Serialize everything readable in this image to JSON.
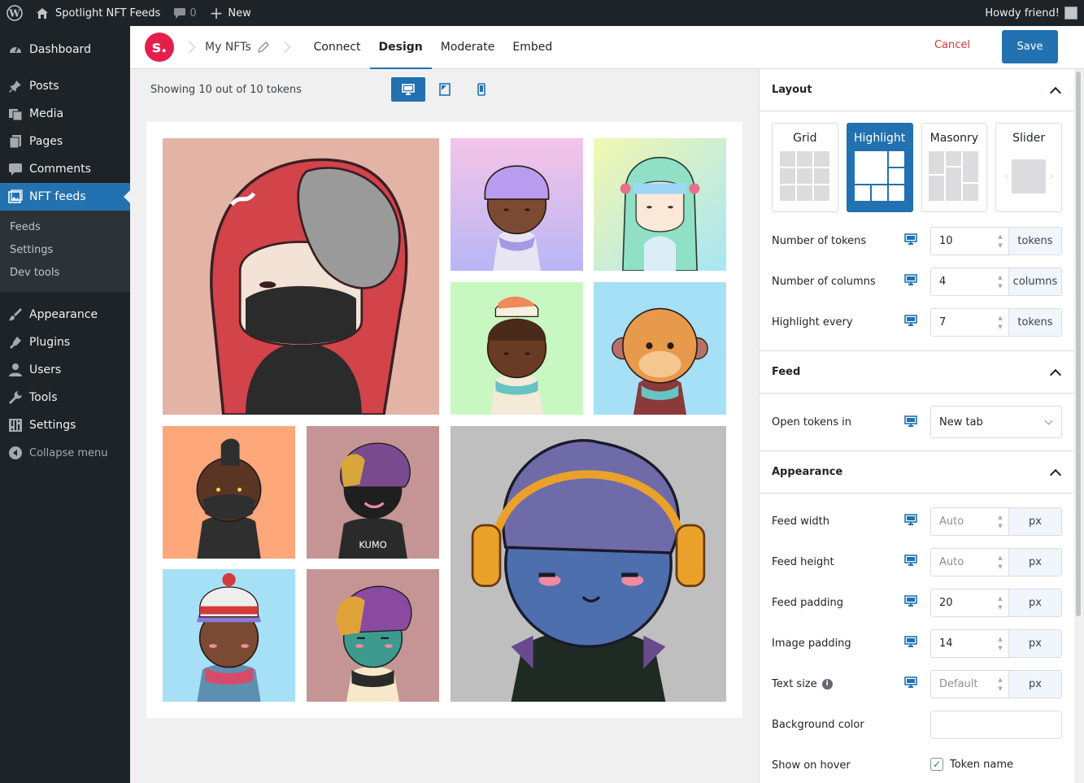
{
  "admin_bar": {
    "site_name": "Spotlight NFT Feeds",
    "comments_count": "0",
    "new_label": "New",
    "greeting": "Howdy friend!"
  },
  "sidebar": {
    "items": [
      {
        "label": "Dashboard",
        "icon": "dashboard-icon"
      },
      {
        "label": "Posts",
        "icon": "pin-icon"
      },
      {
        "label": "Media",
        "icon": "media-icon"
      },
      {
        "label": "Pages",
        "icon": "pages-icon"
      },
      {
        "label": "Comments",
        "icon": "comment-icon"
      },
      {
        "label": "NFT feeds",
        "icon": "gallery-icon"
      },
      {
        "label": "Appearance",
        "icon": "brush-icon"
      },
      {
        "label": "Plugins",
        "icon": "plug-icon"
      },
      {
        "label": "Users",
        "icon": "user-icon"
      },
      {
        "label": "Tools",
        "icon": "wrench-icon"
      },
      {
        "label": "Settings",
        "icon": "sliders-icon"
      }
    ],
    "submenu": [
      "Feeds",
      "Settings",
      "Dev tools"
    ],
    "collapse_label": "Collapse menu"
  },
  "header": {
    "logo_letter": "s.",
    "feed_name": "My NFTs",
    "tabs": [
      "Connect",
      "Design",
      "Moderate",
      "Embed"
    ],
    "active_tab": "Design",
    "cancel_label": "Cancel",
    "save_label": "Save"
  },
  "preview": {
    "showing_text": "Showing 10 out of 10 tokens",
    "devices": [
      "desktop",
      "tablet",
      "phone"
    ],
    "active_device": "desktop",
    "tiles": [
      {
        "name": "nft-red-masked",
        "bg": "#e3b3a5"
      },
      {
        "name": "nft-purple-hair",
        "bg": "#e3c6f0"
      },
      {
        "name": "nft-green-hood",
        "bg": "#cbeee0"
      },
      {
        "name": "nft-sushi-hat",
        "bg": "#c9f7c1"
      },
      {
        "name": "nft-monkey",
        "bg": "#a6e0f7"
      },
      {
        "name": "nft-dark-mask",
        "bg": "#fda77a"
      },
      {
        "name": "nft-kumo",
        "bg": "#c59595"
      },
      {
        "name": "nft-headphones",
        "bg": "#bfbfbf"
      },
      {
        "name": "nft-beanie",
        "bg": "#a6e0f7"
      },
      {
        "name": "nft-teal-face",
        "bg": "#c59595"
      }
    ],
    "kumo_text": "KUMO"
  },
  "panel": {
    "layout": {
      "title": "Layout",
      "options": [
        "Grid",
        "Highlight",
        "Masonry",
        "Slider"
      ],
      "selected": "Highlight",
      "fields": [
        {
          "label": "Number of tokens",
          "value": "10",
          "unit": "tokens"
        },
        {
          "label": "Number of columns",
          "value": "4",
          "unit": "columns"
        },
        {
          "label": "Highlight every",
          "value": "7",
          "unit": "tokens"
        }
      ]
    },
    "feed": {
      "title": "Feed",
      "open_label": "Open tokens in",
      "open_value": "New tab"
    },
    "appearance": {
      "title": "Appearance",
      "fields": [
        {
          "label": "Feed width",
          "value": "",
          "placeholder": "Auto",
          "unit": "px"
        },
        {
          "label": "Feed height",
          "value": "",
          "placeholder": "Auto",
          "unit": "px"
        },
        {
          "label": "Feed padding",
          "value": "20",
          "placeholder": "",
          "unit": "px"
        },
        {
          "label": "Image padding",
          "value": "14",
          "placeholder": "",
          "unit": "px"
        },
        {
          "label": "Text size",
          "value": "",
          "placeholder": "Default",
          "unit": "px"
        }
      ],
      "bg_color_label": "Background color",
      "hover_label": "Show on hover",
      "hover_option": "Token name",
      "hover_checked": true
    }
  },
  "colors": {
    "accent": "#2271b1",
    "sidebar": "#1d2327",
    "brand": "#e51e4b",
    "danger": "#d63638"
  }
}
